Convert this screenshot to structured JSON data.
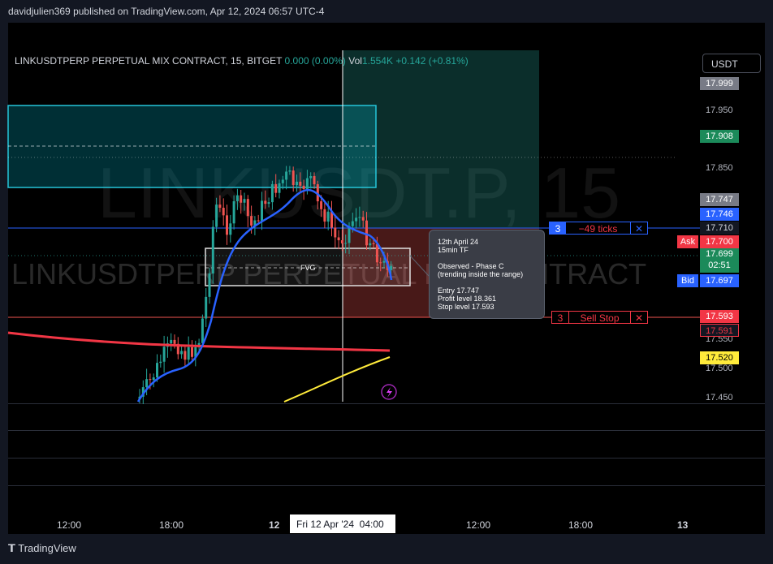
{
  "publish_line": "davidjulien369 published on TradingView.com, Apr 12, 2024 06:57 UTC-4",
  "header": {
    "symbol": "LINKUSDTPERP PERPETUAL MIX CONTRACT, 15, BITGET",
    "change": "0.000 (0.00%)",
    "vol_label": "Vol",
    "vol_value": "1.554K",
    "vol_change": "+0.142 (+0.81%)"
  },
  "currency_button": "USDT",
  "watermark": {
    "big": "LINKUSDT.P, 15",
    "small": "LINKUSDTPERP PERPETUAL MIX CONTRACT"
  },
  "price_axis": {
    "labels": [
      "17.950",
      "17.850",
      "17.550",
      "17.500",
      "17.450"
    ],
    "tags": {
      "top": "17.999",
      "target": "17.908",
      "entry": "17.747",
      "line_blue": "17.746",
      "mid": "17.710",
      "ask_label": "Ask",
      "ask": "17.700",
      "last": "17.699",
      "countdown": "02:51",
      "bid_label": "Bid",
      "bid": "17.697",
      "stop": "17.593",
      "stop2": "17.591",
      "ma": "17.520"
    }
  },
  "orders": {
    "ticks_qty": "3",
    "ticks_text": "−49 ticks",
    "stop_qty": "3",
    "stop_text": "Sell Stop",
    "close": "✕"
  },
  "fvg_label": "FVG",
  "tooltip": {
    "l1": "12th April 24",
    "l2": "15min TF",
    "l3": "Observed - Phase C",
    "l4": "(trending inside the range)",
    "l5": "Entry 17.747",
    "l6": "Profit level 18.361",
    "l7": "Stop level 17.593"
  },
  "time_axis": {
    "t1": "12:00",
    "t2": "18:00",
    "t3": "12",
    "cursor": "Fri 12 Apr '24",
    "t4": "04:00",
    "t5": "12:00",
    "t6": "18:00",
    "t7": "13"
  },
  "footer_brand": "TradingView",
  "colors": {
    "up": "#26a69a",
    "down": "#ef5350",
    "blue": "#2962ff",
    "yellow": "#ffeb3b",
    "teal": "#00bcd4"
  }
}
